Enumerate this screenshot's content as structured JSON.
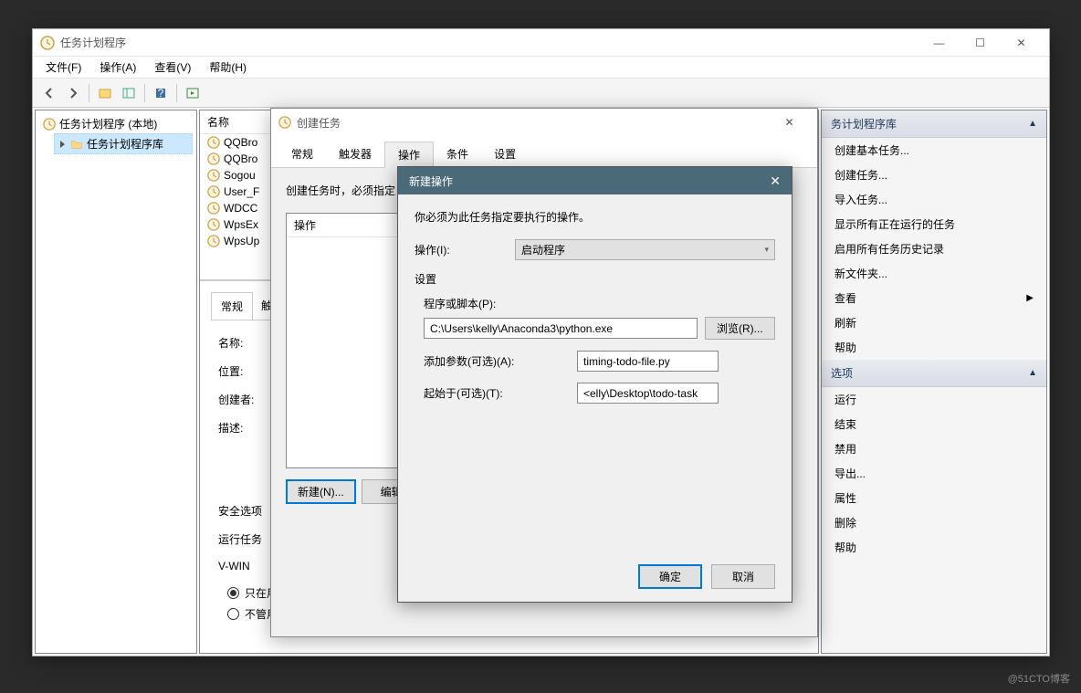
{
  "window": {
    "title": "任务计划程序"
  },
  "menu": {
    "file": "文件(F)",
    "action": "操作(A)",
    "view": "查看(V)",
    "help": "帮助(H)"
  },
  "tree": {
    "root": "任务计划程序 (本地)",
    "lib": "任务计划程序库"
  },
  "tasks": {
    "header": "名称",
    "rows": [
      "QQBro",
      "QQBro",
      "Sogou",
      "User_F",
      "WDCC",
      "WpsEx",
      "WpsUp"
    ]
  },
  "detail": {
    "tab_general": "常规",
    "tab_trigger": "触",
    "name": "名称:",
    "location": "位置:",
    "creator": "创建者:",
    "description": "描述:",
    "security": "安全选项",
    "run_account": "运行任务",
    "account": "V-WIN",
    "radio1": "只在用户登录时运行",
    "radio2": "不管用户是否登录都要运行"
  },
  "actions": {
    "header1": "务计划程序库",
    "items1": [
      "创建基本任务...",
      "创建任务...",
      "导入任务...",
      "显示所有正在运行的任务",
      "启用所有任务历史记录",
      "新文件夹...",
      "查看",
      "刷新",
      "帮助"
    ],
    "header2": "选项",
    "items2": [
      "运行",
      "结束",
      "禁用",
      "导出...",
      "属性",
      "删除",
      "帮助"
    ]
  },
  "dialog1": {
    "title": "创建任务",
    "tabs": [
      "常规",
      "触发器",
      "操作",
      "条件",
      "设置"
    ],
    "hint": "创建任务时，必须指定",
    "list_header": "操作",
    "btn_new": "新建(N)...",
    "btn_edit": "编辑("
  },
  "dialog2": {
    "title": "新建操作",
    "hint": "你必须为此任务指定要执行的操作。",
    "action_label": "操作(I):",
    "action_value": "启动程序",
    "settings_label": "设置",
    "program_label": "程序或脚本(P):",
    "program_value": "C:\\Users\\kelly\\Anaconda3\\python.exe",
    "browse": "浏览(R)...",
    "args_label": "添加参数(可选)(A):",
    "args_value": "timing-todo-file.py",
    "start_label": "起始于(可选)(T):",
    "start_value": "<elly\\Desktop\\todo-task",
    "ok": "确定",
    "cancel": "取消"
  },
  "watermark": "@51CTO博客"
}
